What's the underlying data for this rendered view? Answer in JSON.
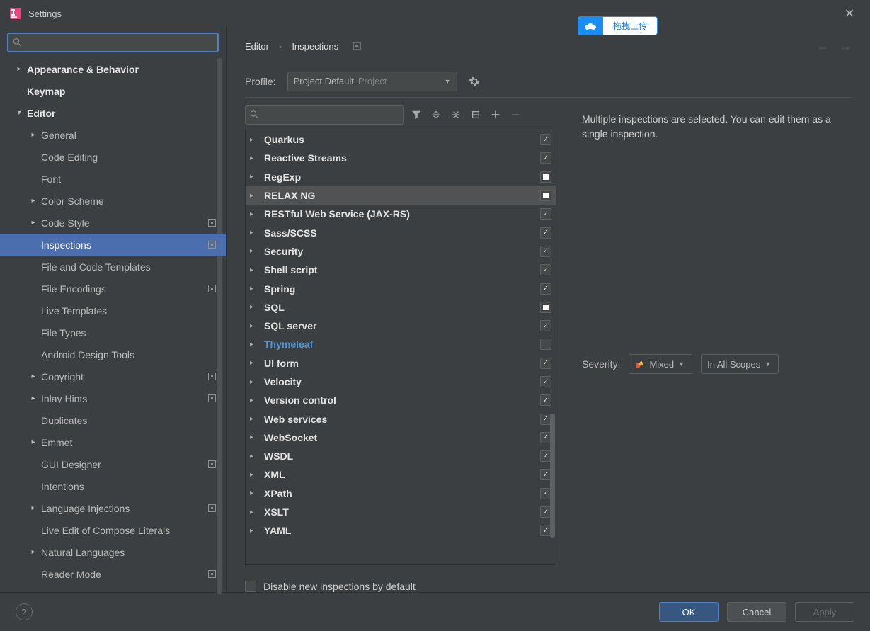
{
  "window": {
    "title": "Settings"
  },
  "upload": {
    "label": "拖拽上传"
  },
  "breadcrumb": {
    "parent": "Editor",
    "current": "Inspections"
  },
  "profile": {
    "label": "Profile:",
    "value": "Project Default",
    "scope": "Project"
  },
  "sidebar": {
    "items": [
      {
        "label": "Appearance & Behavior",
        "depth": 0,
        "chev": true,
        "bold": true
      },
      {
        "label": "Keymap",
        "depth": 0,
        "bold": true
      },
      {
        "label": "Editor",
        "depth": 0,
        "chev": true,
        "open": true,
        "bold": true
      },
      {
        "label": "General",
        "depth": 1,
        "chev": true
      },
      {
        "label": "Code Editing",
        "depth": 1
      },
      {
        "label": "Font",
        "depth": 1
      },
      {
        "label": "Color Scheme",
        "depth": 1,
        "chev": true
      },
      {
        "label": "Code Style",
        "depth": 1,
        "chev": true,
        "badge": true
      },
      {
        "label": "Inspections",
        "depth": 1,
        "selected": true,
        "badge": true
      },
      {
        "label": "File and Code Templates",
        "depth": 1
      },
      {
        "label": "File Encodings",
        "depth": 1,
        "badge": true
      },
      {
        "label": "Live Templates",
        "depth": 1
      },
      {
        "label": "File Types",
        "depth": 1
      },
      {
        "label": "Android Design Tools",
        "depth": 1
      },
      {
        "label": "Copyright",
        "depth": 1,
        "chev": true,
        "badge": true
      },
      {
        "label": "Inlay Hints",
        "depth": 1,
        "chev": true,
        "badge": true
      },
      {
        "label": "Duplicates",
        "depth": 1
      },
      {
        "label": "Emmet",
        "depth": 1,
        "chev": true
      },
      {
        "label": "GUI Designer",
        "depth": 1,
        "badge": true
      },
      {
        "label": "Intentions",
        "depth": 1
      },
      {
        "label": "Language Injections",
        "depth": 1,
        "chev": true,
        "badge": true
      },
      {
        "label": "Live Edit of Compose Literals",
        "depth": 1
      },
      {
        "label": "Natural Languages",
        "depth": 1,
        "chev": true
      },
      {
        "label": "Reader Mode",
        "depth": 1,
        "badge": true
      }
    ]
  },
  "inspections": [
    {
      "name": "Quarkus",
      "state": "checked"
    },
    {
      "name": "Reactive Streams",
      "state": "checked"
    },
    {
      "name": "RegExp",
      "state": "mixed"
    },
    {
      "name": "RELAX NG",
      "state": "mixed",
      "sel": true
    },
    {
      "name": "RESTful Web Service (JAX-RS)",
      "state": "checked"
    },
    {
      "name": "Sass/SCSS",
      "state": "checked"
    },
    {
      "name": "Security",
      "state": "checked"
    },
    {
      "name": "Shell script",
      "state": "checked"
    },
    {
      "name": "Spring",
      "state": "checked"
    },
    {
      "name": "SQL",
      "state": "mixed"
    },
    {
      "name": "SQL server",
      "state": "checked"
    },
    {
      "name": "Thymeleaf",
      "state": "none",
      "hl": true
    },
    {
      "name": "UI form",
      "state": "checked"
    },
    {
      "name": "Velocity",
      "state": "checked"
    },
    {
      "name": "Version control",
      "state": "checked"
    },
    {
      "name": "Web services",
      "state": "checked"
    },
    {
      "name": "WebSocket",
      "state": "checked"
    },
    {
      "name": "WSDL",
      "state": "checked"
    },
    {
      "name": "XML",
      "state": "checked"
    },
    {
      "name": "XPath",
      "state": "checked"
    },
    {
      "name": "XSLT",
      "state": "checked"
    },
    {
      "name": "YAML",
      "state": "checked"
    }
  ],
  "info_text": "Multiple inspections are selected. You can edit them as a single inspection.",
  "severity": {
    "label": "Severity:",
    "value": "Mixed",
    "scope": "In All Scopes"
  },
  "disable_label": "Disable new inspections by default",
  "footer": {
    "ok": "OK",
    "cancel": "Cancel",
    "apply": "Apply"
  }
}
